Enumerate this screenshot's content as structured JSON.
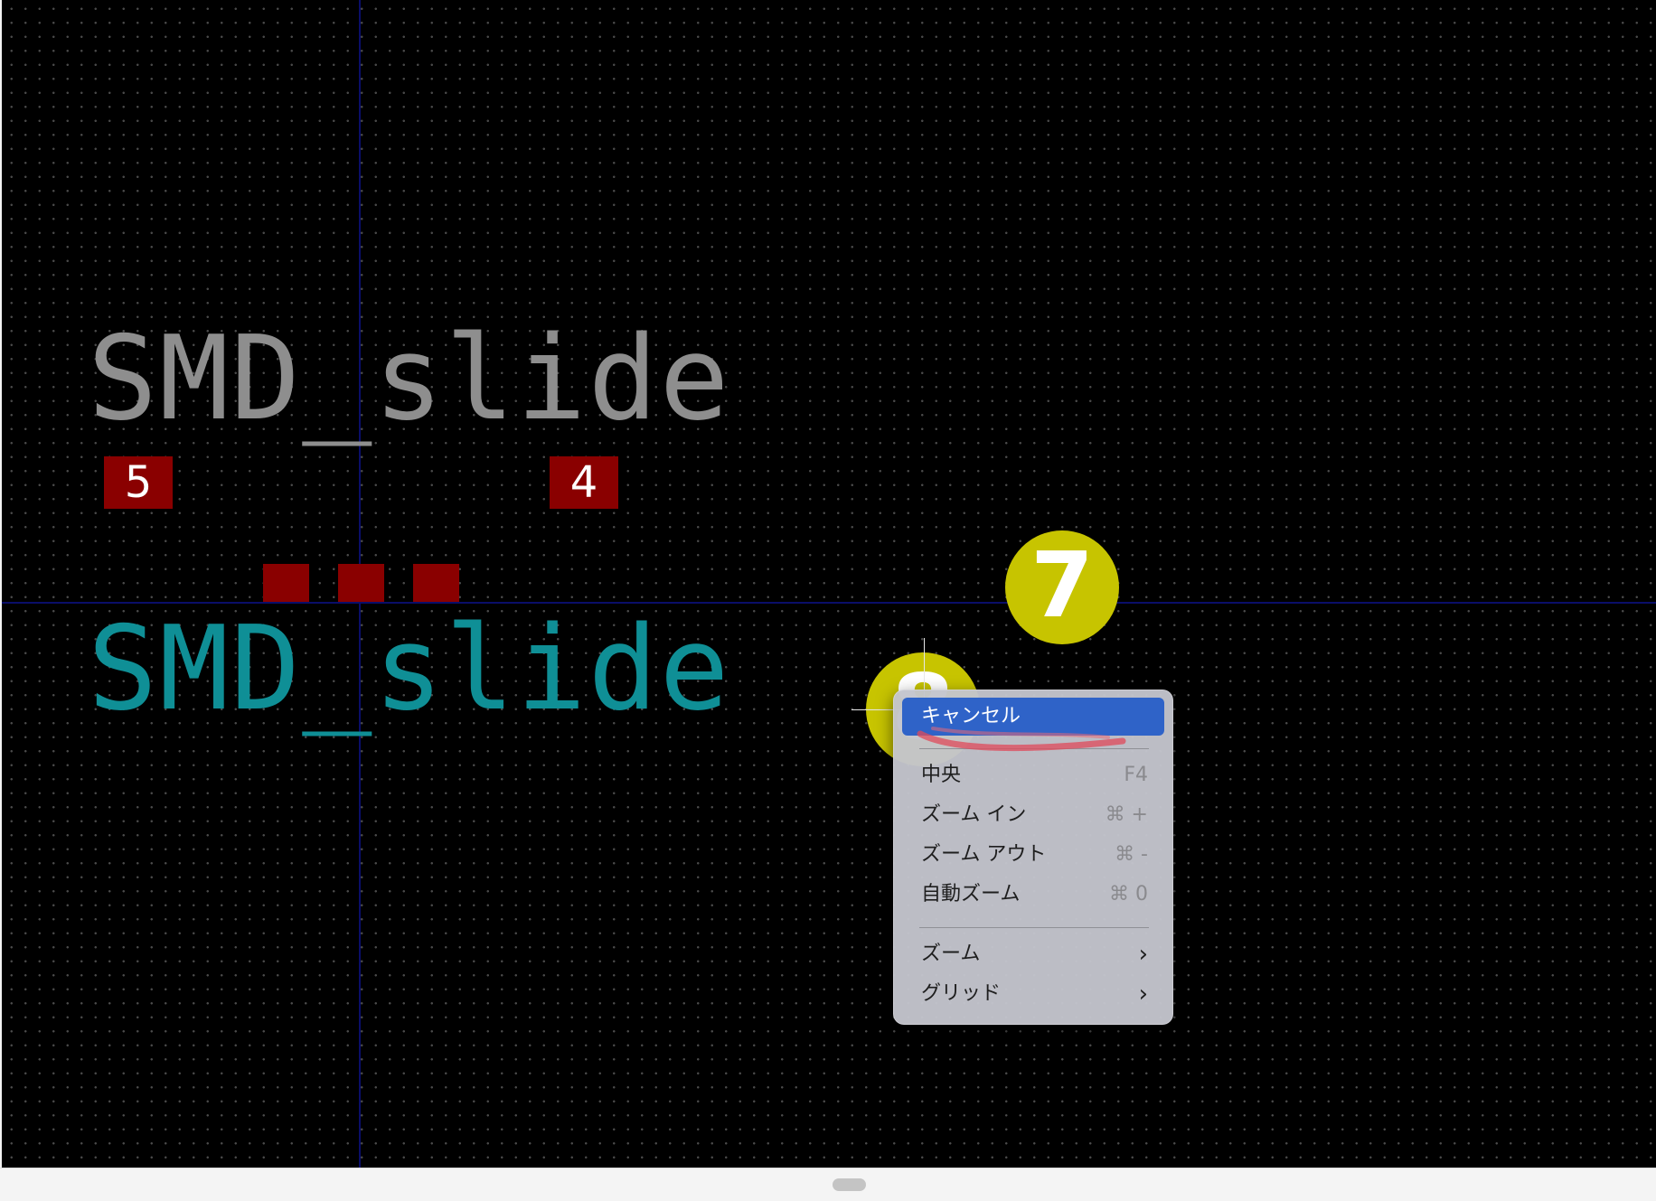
{
  "footprint": {
    "reference_text": "SMD_slide",
    "value_text": "SMD_slide",
    "reference_color": "#8e8e8e",
    "value_color": "#0f8f96",
    "pad_color": "#8a0000"
  },
  "pads": {
    "labels": [
      "5",
      "4"
    ]
  },
  "markers": {
    "step_7": "7",
    "step_8": "8",
    "color": "#c7c400"
  },
  "context_menu": {
    "items": [
      {
        "label": "キャンセル",
        "shortcut": "",
        "selected": true
      },
      {
        "label": "中央",
        "shortcut": "F4"
      },
      {
        "label": "ズーム イン",
        "shortcut": "⌘ +"
      },
      {
        "label": "ズーム アウト",
        "shortcut": "⌘ -"
      },
      {
        "label": "自動ズーム",
        "shortcut": "⌘ 0"
      },
      {
        "label": "ズーム",
        "submenu": true
      },
      {
        "label": "グリッド",
        "submenu": true
      }
    ],
    "highlight_color": "#2f63c8"
  },
  "canvas": {
    "background_color": "#000000",
    "axis_color": "#0a0e6a"
  }
}
